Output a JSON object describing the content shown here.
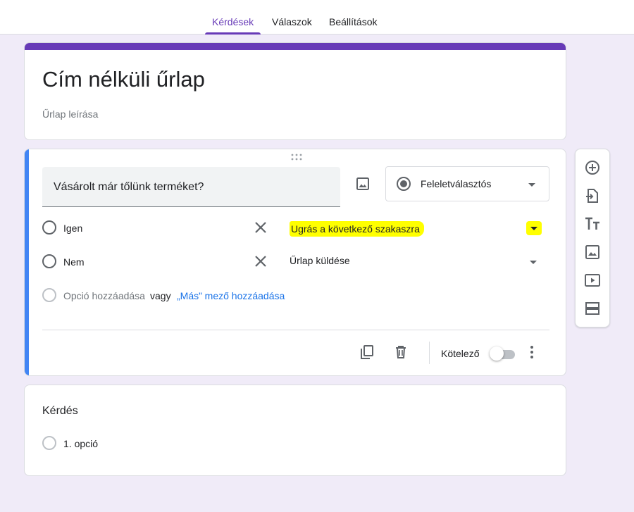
{
  "tabs": [
    {
      "label": "Kérdések",
      "active": true
    },
    {
      "label": "Válaszok",
      "active": false
    },
    {
      "label": "Beállítások",
      "active": false
    }
  ],
  "form": {
    "title": "Cím nélküli űrlap",
    "description_placeholder": "Űrlap leírása"
  },
  "question": {
    "title": "Vásárolt már tőlünk terméket?",
    "type": "Feleletválasztós",
    "options": [
      {
        "label": "Igen",
        "goto": "Ugrás a következő szakaszra",
        "highlighted": true
      },
      {
        "label": "Nem",
        "goto": "Űrlap küldése",
        "highlighted": false
      }
    ],
    "add_option": "Opció hozzáadása",
    "or": "vagy",
    "add_other": "„Más” mező hozzáadása",
    "required_label": "Kötelező",
    "required": false
  },
  "question2": {
    "title": "Kérdés",
    "option": "1. opció"
  },
  "colors": {
    "accent": "#673ab7",
    "active_question": "#4285f4",
    "link": "#1a73e8",
    "highlight": "#ffff00",
    "background": "#f0ebf8"
  },
  "icons": [
    "drag-handle-icon",
    "image-icon",
    "radio-button-icon",
    "chevron-down-icon",
    "close-icon",
    "copy-icon",
    "delete-icon",
    "more-vert-icon",
    "add-circle-icon",
    "import-icon",
    "title-icon",
    "image-icon",
    "video-icon",
    "section-icon"
  ]
}
